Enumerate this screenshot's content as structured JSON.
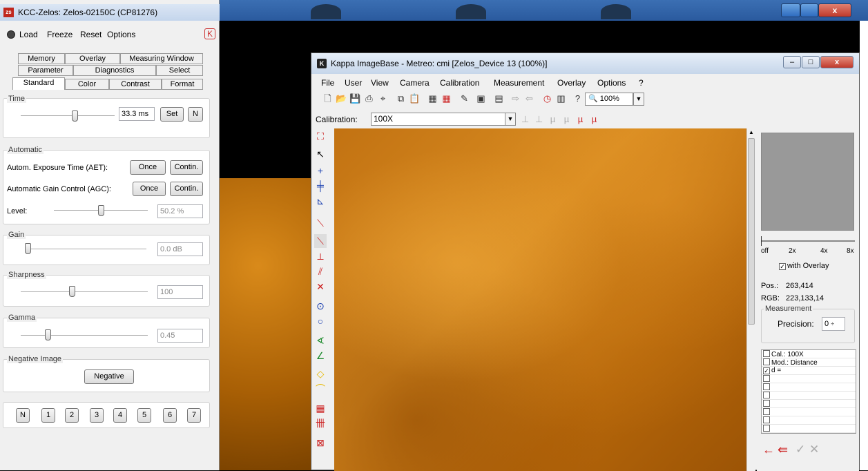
{
  "kcc": {
    "title": "KCC-Zelos: Zelos-02150C (CP81276)",
    "app_badge": "zs",
    "menu": [
      "Load",
      "Freeze",
      "Reset",
      "Options"
    ],
    "menu_logo": "K",
    "tabs_row1": [
      "Memory",
      "Overlay",
      "Measuring Window"
    ],
    "tabs_row2": [
      "Parameter",
      "Diagnostics",
      "Select"
    ],
    "tabs_row3": [
      "Standard",
      "Color",
      "Contrast",
      "Format"
    ],
    "time": {
      "label": "Time",
      "value": "33.3 ms",
      "set_label": "Set",
      "n_label": "N",
      "level": 0.58
    },
    "automatic": {
      "label": "Automatic",
      "aet_label": "Autom. Exposure Time (AET):",
      "agc_label": "Automatic Gain Control (AGC):",
      "once_label": "Once",
      "contin_label": "Contin.",
      "level_label": "Level:",
      "level_value": "50.2 %",
      "level": 0.5
    },
    "gain": {
      "label": "Gain",
      "value": "0.0 dB",
      "level": 0.0
    },
    "sharpness": {
      "label": "Sharpness",
      "value": "100",
      "level": 0.4
    },
    "gamma": {
      "label": "Gamma",
      "value": "0.45",
      "level": 0.2
    },
    "negative": {
      "label": "Negative Image",
      "button": "Negative"
    },
    "presets": [
      "N",
      "1",
      "2",
      "3",
      "4",
      "5",
      "6",
      "7"
    ]
  },
  "kappa": {
    "title": "Kappa ImageBase - Metreo: cmi [Zelos_Device 13 (100%)]",
    "logo": "K",
    "menu": [
      "File",
      "User",
      "View",
      "Camera",
      "Calibration",
      "Measurement",
      "Overlay",
      "Options",
      "?"
    ],
    "zoom": "100%",
    "calibration_label": "Calibration:",
    "calibration_value": "100X",
    "zoom_ticks": [
      "off",
      "2x",
      "4x",
      "8x"
    ],
    "with_overlay": "with Overlay",
    "pos_label": "Pos.:",
    "pos_value": "263,414",
    "rgb_label": "RGB:",
    "rgb_value": "223,133,14",
    "measurement": {
      "label": "Measurement",
      "precision_label": "Precision:",
      "precision_value": "0",
      "rows": [
        "Cal.: 100X",
        "Mod.: Distance",
        "d ="
      ]
    }
  },
  "colors": {
    "accent_red": "#cc1e1e",
    "micro_orange": "#c97a15",
    "titlebar_blue": "#2a5a9e"
  }
}
